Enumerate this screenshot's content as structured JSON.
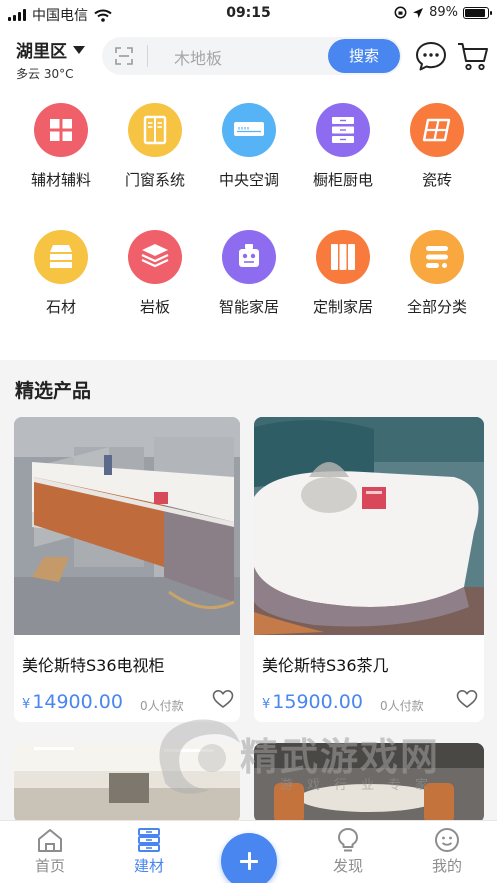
{
  "status_bar": {
    "carrier": "中国电信",
    "time": "09:15",
    "battery": "89%",
    "battery_level": 0.89
  },
  "header": {
    "location": "湖里区",
    "weather": "多云 30°C",
    "search_placeholder": "木地板",
    "search_button": "搜索"
  },
  "categories": [
    {
      "label": "辅材辅料",
      "icon": "auxiliary-materials-icon",
      "color": "#f0606a"
    },
    {
      "label": "门窗系统",
      "icon": "door-window-icon",
      "color": "#f6c343"
    },
    {
      "label": "中央空调",
      "icon": "air-conditioner-icon",
      "color": "#56b3f6"
    },
    {
      "label": "橱柜厨电",
      "icon": "cabinet-icon",
      "color": "#8e6cf0"
    },
    {
      "label": "瓷砖",
      "icon": "tile-icon",
      "color": "#f87a3c"
    },
    {
      "label": "石材",
      "icon": "stone-icon",
      "color": "#f6c343"
    },
    {
      "label": "岩板",
      "icon": "slab-icon",
      "color": "#f0606a"
    },
    {
      "label": "智能家居",
      "icon": "smart-home-icon",
      "color": "#8e6cf0"
    },
    {
      "label": "定制家居",
      "icon": "custom-furniture-icon",
      "color": "#f87a3c"
    },
    {
      "label": "全部分类",
      "icon": "all-categories-icon",
      "color": "#f8a83e"
    }
  ],
  "featured": {
    "title": "精选产品",
    "products": [
      {
        "name": "美伦斯特S36电视柜",
        "currency": "¥",
        "price": "14900.00",
        "paid": "0人付款"
      },
      {
        "name": "美伦斯特S36茶几",
        "currency": "¥",
        "price": "15900.00",
        "paid": "0人付款"
      }
    ]
  },
  "watermark": {
    "text": "精武游戏网",
    "sub": "游戏行业专家"
  },
  "tabs": [
    {
      "label": "首页",
      "icon": "home-icon",
      "active": false
    },
    {
      "label": "建材",
      "icon": "building-materials-icon",
      "active": true
    },
    {
      "label": "",
      "icon": "add-icon",
      "active": false
    },
    {
      "label": "发现",
      "icon": "discover-icon",
      "active": false
    },
    {
      "label": "我的",
      "icon": "profile-icon",
      "active": false
    }
  ],
  "colors": {
    "accent": "#4a86f0",
    "price": "#4a86f0"
  }
}
